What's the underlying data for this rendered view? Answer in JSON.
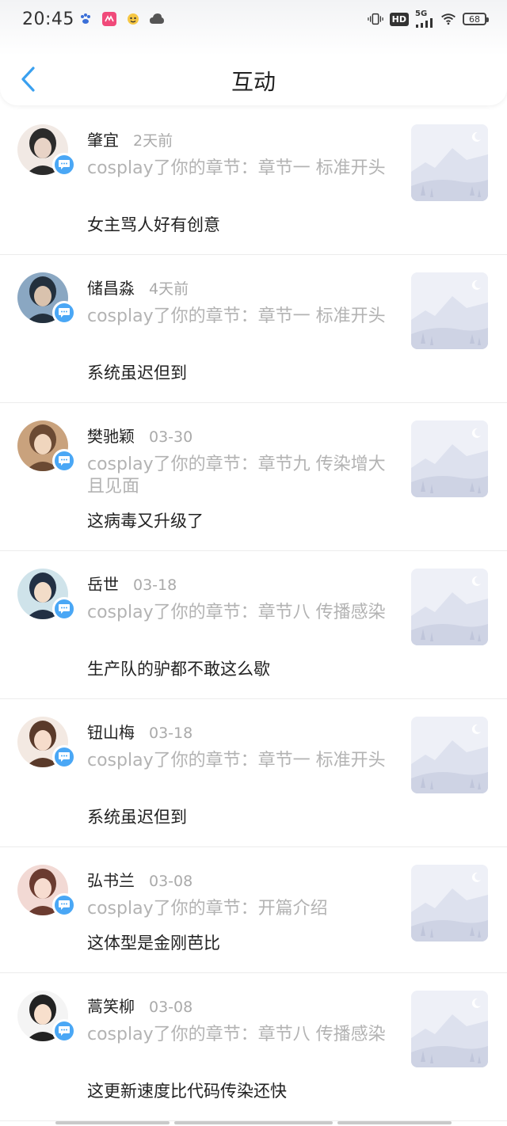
{
  "status_bar": {
    "time": "20:45",
    "battery": "68",
    "network": "5G",
    "hd": "HD"
  },
  "header": {
    "title": "互动",
    "back_icon": "chevron-left-icon"
  },
  "colors": {
    "accent": "#4aa7f5",
    "primary_text": "#222222",
    "secondary_text": "#b3b3b3"
  },
  "items": [
    {
      "name": "肇宜",
      "time": "2天前",
      "action": "cosplay了你的章节：章节一 标准开头",
      "comment": "女主骂人好有创意"
    },
    {
      "name": "储昌淼",
      "time": "4天前",
      "action": "cosplay了你的章节：章节一 标准开头",
      "comment": "系统虽迟但到"
    },
    {
      "name": "樊驰颖",
      "time": "03-30",
      "action": "cosplay了你的章节：章节九 传染增大且见面",
      "comment": "这病毒又升级了"
    },
    {
      "name": "岳世",
      "time": "03-18",
      "action": "cosplay了你的章节：章节八 传播感染",
      "comment": "生产队的驴都不敢这么歇"
    },
    {
      "name": "钮山梅",
      "time": "03-18",
      "action": "cosplay了你的章节：章节一 标准开头",
      "comment": "系统虽迟但到"
    },
    {
      "name": "弘书兰",
      "time": "03-08",
      "action": "cosplay了你的章节：开篇介绍",
      "comment": "这体型是金刚芭比"
    },
    {
      "name": "蒿笑柳",
      "time": "03-08",
      "action": "cosplay了你的章节：章节八 传播感染",
      "comment": "这更新速度比代码传染还快"
    }
  ]
}
